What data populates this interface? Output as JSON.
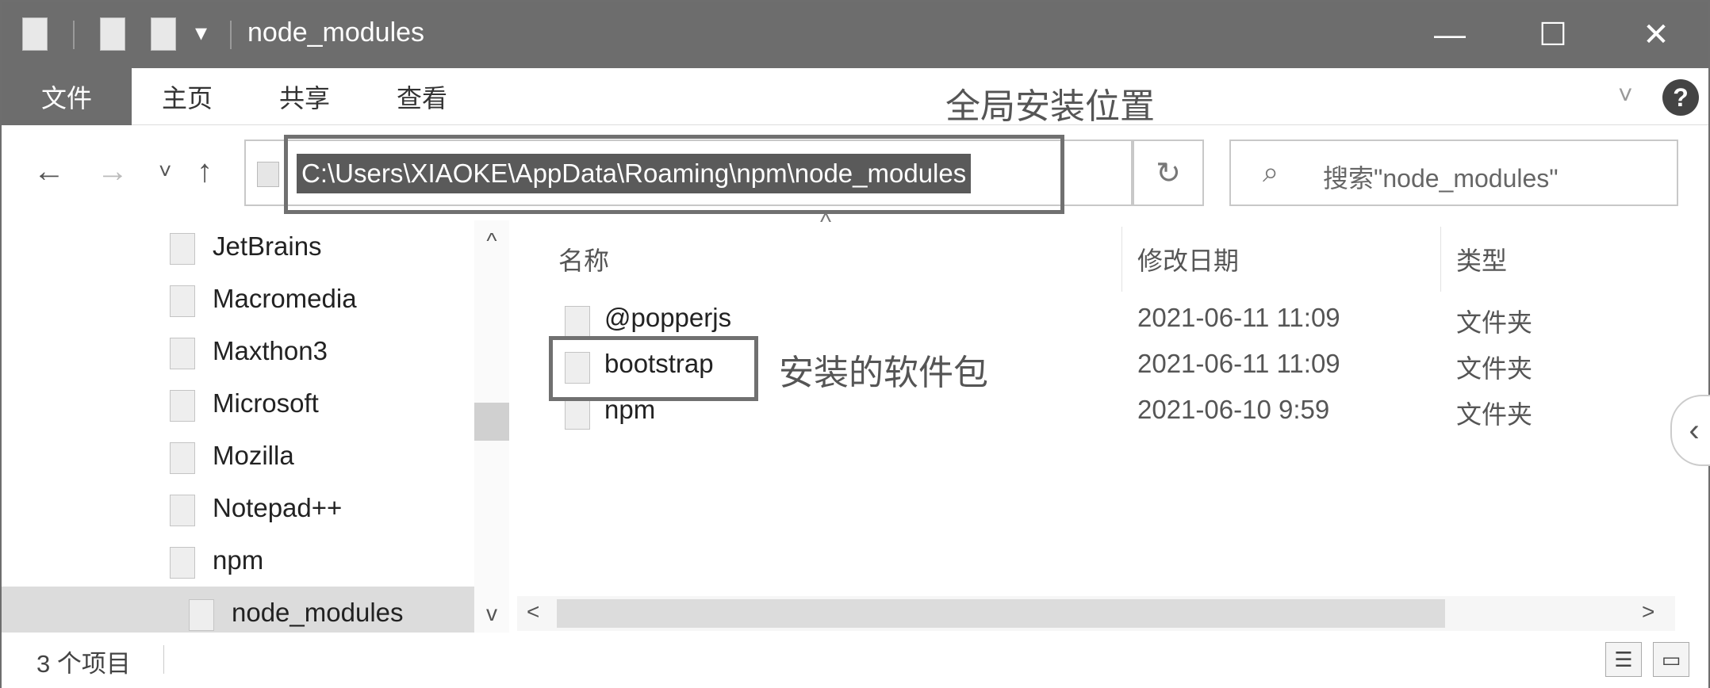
{
  "window": {
    "title": "node_modules",
    "qat_dropdown": "▾",
    "controls": {
      "minimize": "—",
      "maximize": "☐",
      "close": "✕"
    }
  },
  "ribbon": {
    "tabs": [
      "文件",
      "主页",
      "共享",
      "查看"
    ],
    "expand_icon": "chevron-down-icon",
    "help_label": "?"
  },
  "annotations": {
    "global_install": "全局安装位置",
    "installed_package": "安装的软件包"
  },
  "nav": {
    "back": "←",
    "forward": "→",
    "recent": "˅",
    "up": "↑"
  },
  "address": {
    "path": "C:\\Users\\XIAOKE\\AppData\\Roaming\\npm\\node_modules",
    "dropdown": "˅",
    "refresh": "↻"
  },
  "search": {
    "icon": "⌕",
    "placeholder": "搜索\"node_modules\""
  },
  "nav_pane": {
    "items": [
      {
        "label": "JetBrains"
      },
      {
        "label": "Macromedia"
      },
      {
        "label": "Maxthon3"
      },
      {
        "label": "Microsoft"
      },
      {
        "label": "Mozilla"
      },
      {
        "label": "Notepad++"
      },
      {
        "label": "npm"
      },
      {
        "label": "node_modules",
        "selected": true
      }
    ],
    "scroll_up": "^",
    "scroll_down": "v"
  },
  "columns": {
    "name": "名称",
    "modified": "修改日期",
    "type": "类型",
    "sort_indicator": "^"
  },
  "files": [
    {
      "name": "@popperjs",
      "modified": "2021-06-11 11:09",
      "type": "文件夹"
    },
    {
      "name": "bootstrap",
      "modified": "2021-06-11 11:09",
      "type": "文件夹"
    },
    {
      "name": "npm",
      "modified": "2021-06-10 9:59",
      "type": "文件夹"
    }
  ],
  "hscroll": {
    "left": "<",
    "right": ">"
  },
  "side_panel_toggle": "‹",
  "status": {
    "item_count": "3 个项目",
    "details_view_icon": "☰",
    "large_icons_view_icon": "▭"
  }
}
